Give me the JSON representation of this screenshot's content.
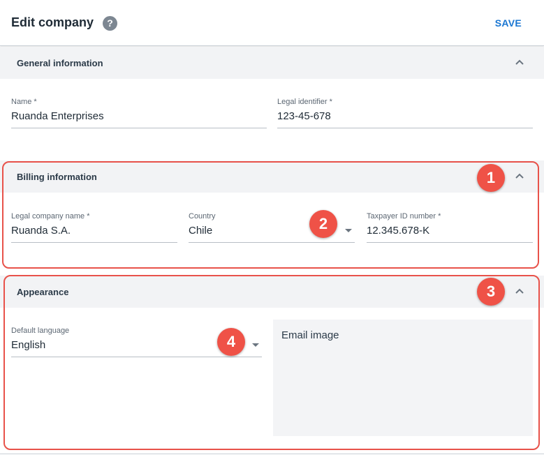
{
  "header": {
    "title": "Edit company",
    "help_icon": "?",
    "save_label": "SAVE"
  },
  "general": {
    "title": "General information",
    "name": {
      "label": "Name *",
      "value": "Ruanda Enterprises"
    },
    "legal_identifier": {
      "label": "Legal identifier *",
      "value": "123-45-678"
    }
  },
  "billing": {
    "title": "Billing information",
    "legal_company_name": {
      "label": "Legal company name *",
      "value": "Ruanda S.A."
    },
    "country": {
      "label": "Country",
      "value": "Chile"
    },
    "taxpayer_id": {
      "label": "Taxpayer ID number *",
      "value": "12.345.678-K"
    }
  },
  "appearance": {
    "title": "Appearance",
    "default_language": {
      "label": "Default language",
      "value": "English"
    },
    "email_image": {
      "label": "Email image"
    }
  },
  "annotations": {
    "badge_1": "1",
    "badge_2": "2",
    "badge_3": "3",
    "badge_4": "4",
    "color": "#ef5247"
  },
  "icons": [
    "help-icon",
    "chevron-up-icon",
    "dropdown-arrow-icon"
  ]
}
